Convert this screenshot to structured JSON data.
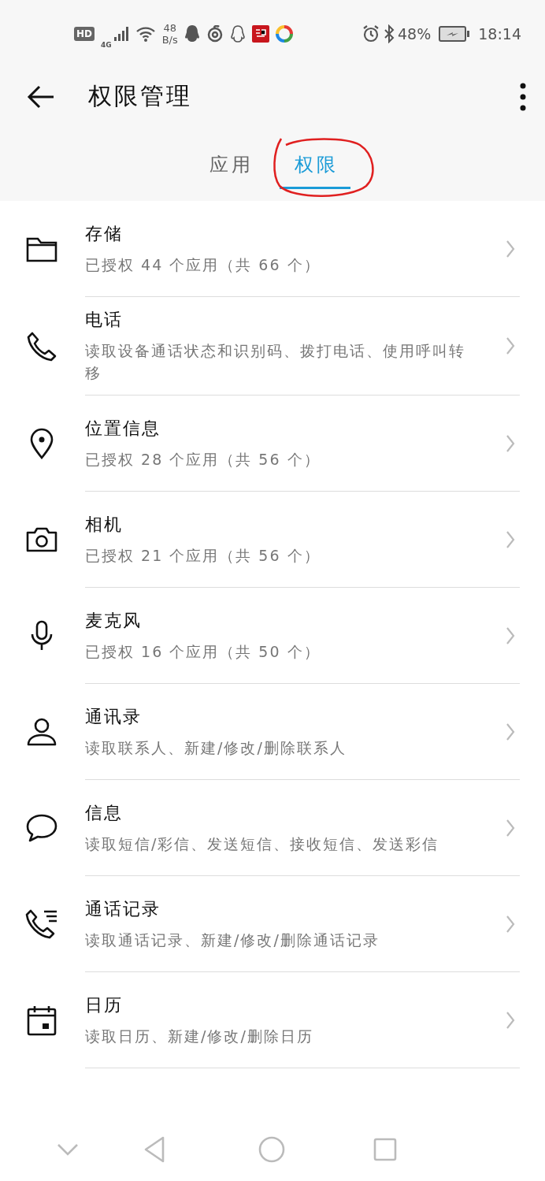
{
  "status_bar": {
    "hd": "HD",
    "network": "4G",
    "speed_value": "48",
    "speed_unit": "B/s",
    "battery": "48%",
    "time": "18:14"
  },
  "app_bar": {
    "title": "权限管理"
  },
  "tabs": [
    {
      "label": "应用",
      "selected": false,
      "circled": false
    },
    {
      "label": "权限",
      "selected": true,
      "circled": true
    }
  ],
  "annotation": {
    "kind": "hand-drawn-circle"
  },
  "permissions": [
    {
      "title": "存储",
      "detail": "已授权 44 个应用（共 66 个）"
    },
    {
      "title": "电话",
      "detail": "读取设备通话状态和识别码、拨打电话、使用呼叫转移"
    },
    {
      "title": "位置信息",
      "detail": "已授权 28 个应用（共 56 个）"
    },
    {
      "title": "相机",
      "detail": "已授权 21 个应用（共 56 个）"
    },
    {
      "title": "麦克风",
      "detail": "已授权 16 个应用（共 50 个）"
    },
    {
      "title": "通讯录",
      "detail": "读取联系人、新建/修改/删除联系人"
    },
    {
      "title": "信息",
      "detail": "读取短信/彩信、发送短信、接收短信、发送彩信"
    },
    {
      "title": "通话记录",
      "detail": "读取通话记录、新建/修改/删除通话记录"
    },
    {
      "title": "日历",
      "detail": "读取日历、新建/修改/删除日历"
    }
  ]
}
